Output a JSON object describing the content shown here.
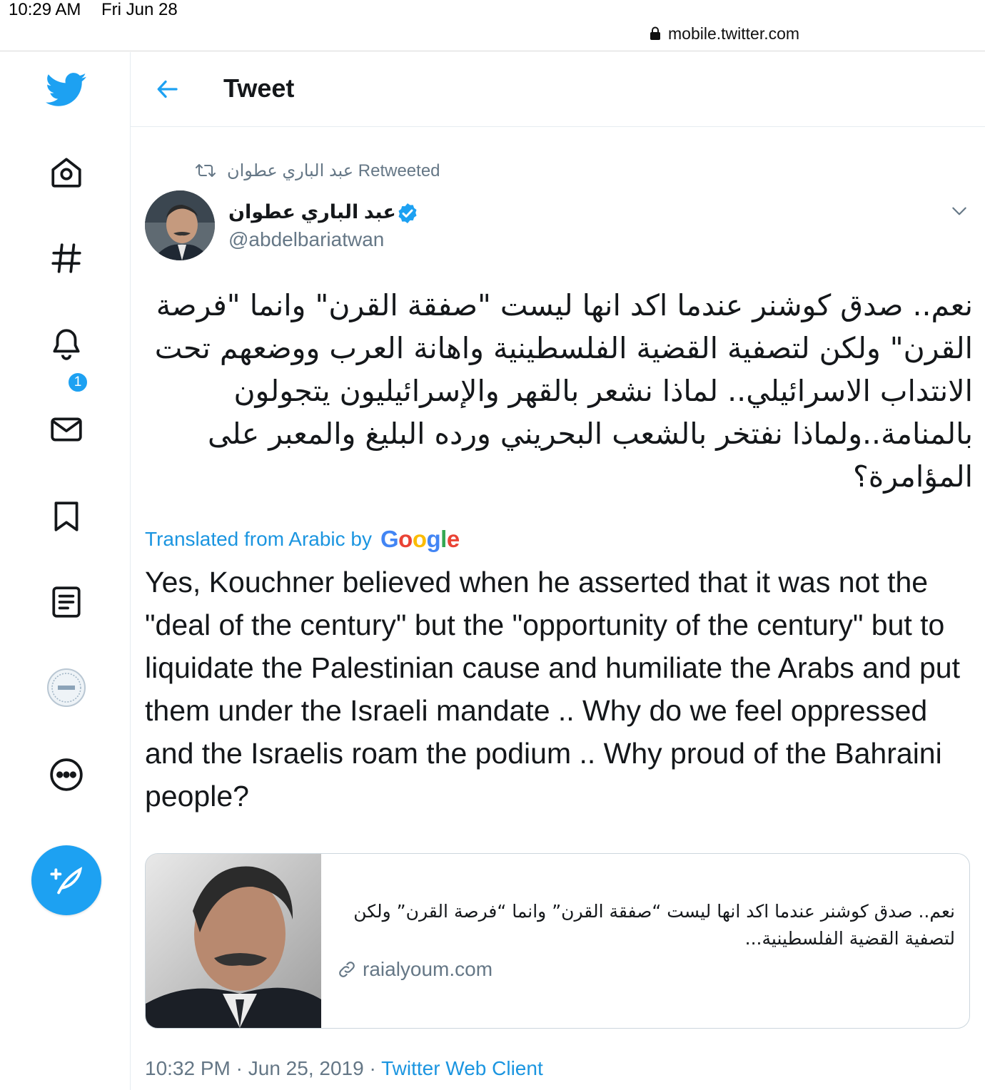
{
  "status_bar": {
    "time": "10:29 AM",
    "date": "Fri Jun 28",
    "url": "mobile.twitter.com"
  },
  "sidebar": {
    "items": [
      {
        "name": "twitter-logo-icon"
      },
      {
        "name": "home-icon"
      },
      {
        "name": "explore-hashtag-icon"
      },
      {
        "name": "notifications-bell-icon",
        "badge": "1"
      },
      {
        "name": "messages-envelope-icon"
      },
      {
        "name": "bookmarks-icon"
      },
      {
        "name": "lists-icon"
      },
      {
        "name": "profile-avatar"
      },
      {
        "name": "more-icon"
      }
    ],
    "compose_icon": "feather-plus-icon"
  },
  "header": {
    "title": "Tweet",
    "back_icon": "arrow-left-icon"
  },
  "tweet": {
    "retweeted_by": "عبد الباري عطوان Retweeted",
    "author_name": "عبد الباري عطوان",
    "author_handle": "@abdelbariatwan",
    "text_ar": "نعم.. صدق كوشنر عندما اكد انها ليست \"صفقة القرن\" وانما \"فرصة القرن\" ولكن لتصفية القضية الفلسطينية واهانة العرب ووضعهم تحت الانتداب الاسرائيلي.. لماذا نشعر بالقهر والإسرائيليون يتجولون بالمنامة..ولماذا نفتخر بالشعب البحريني ورده البليغ والمعبر على المؤامرة؟",
    "translated_label": "Translated from Arabic by",
    "translation_provider": "Google",
    "text_en": "Yes, Kouchner believed when he asserted that it was not the \"deal of the century\" but the \"opportunity of the century\" but to liquidate the Palestinian cause and humiliate the Arabs and put them under the Israeli mandate .. Why do we feel oppressed and the Israelis roam the podium .. Why proud of the Bahraini people?",
    "card": {
      "text": "نعم.. صدق كوشنر عندما اكد انها ليست “صفقة القرن” وانما “فرصة القرن” ولكن لتصفية القضية الفلسطينية...",
      "domain": "raialyoum.com"
    },
    "time": "10:32 PM",
    "date": "Jun 25, 2019",
    "source": "Twitter Web Client",
    "separator": " · "
  },
  "colors": {
    "accent": "#1da1f2",
    "link": "#1b95e0",
    "muted": "#657786",
    "text": "#14171a",
    "border": "#e6ecf0"
  }
}
